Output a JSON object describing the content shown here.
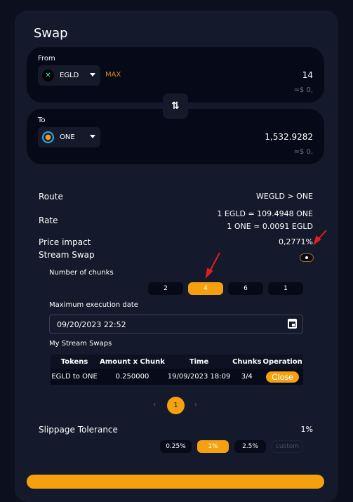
{
  "title": "Swap",
  "from": {
    "label": "From",
    "token": "EGLD",
    "max": "MAX",
    "amount": "14",
    "usd": "≈$ 0,"
  },
  "to": {
    "label": "To",
    "token": "ONE",
    "amount": "1,532.9282",
    "usd": "≈$ 0,"
  },
  "details": {
    "route_label": "Route",
    "route": "WEGLD > ONE",
    "rate_label": "Rate",
    "rate1": "1 EGLD ≃ 109.4948 ONE",
    "rate2": "1 ONE ≃ 0.0091 EGLD",
    "impact_label": "Price impact",
    "impact": "0,2771%",
    "stream_label": "Stream Swap",
    "stream_enabled": true
  },
  "stream": {
    "chunks_label": "Number of chunks",
    "chunks": [
      "2",
      "4",
      "6",
      "1"
    ],
    "selected_chunk": "4",
    "date_label": "Maximum execution date",
    "date": "09/20/2023 22:52",
    "my_label": "My Stream Swaps",
    "headers": [
      "Tokens",
      "Amount x Chunk",
      "Time",
      "Chunks",
      "Operation"
    ],
    "rows": [
      {
        "tokens": "EGLD to ONE",
        "amount": "0.250000",
        "time": "19/09/2023 18:09",
        "chunks": "3/4",
        "op": "Close"
      }
    ],
    "page": "1",
    "prev": "‹",
    "next": "›"
  },
  "slippage": {
    "label": "Slippage Tolerance",
    "value": "1%",
    "options": [
      "0.25%",
      "1%",
      "2.5%"
    ],
    "custom": "custom"
  },
  "colors": {
    "accent": "#f5a00f",
    "background": "#0c0f1d",
    "card": "#141a2b",
    "panel": "#060918",
    "annotation": "#e02020"
  }
}
